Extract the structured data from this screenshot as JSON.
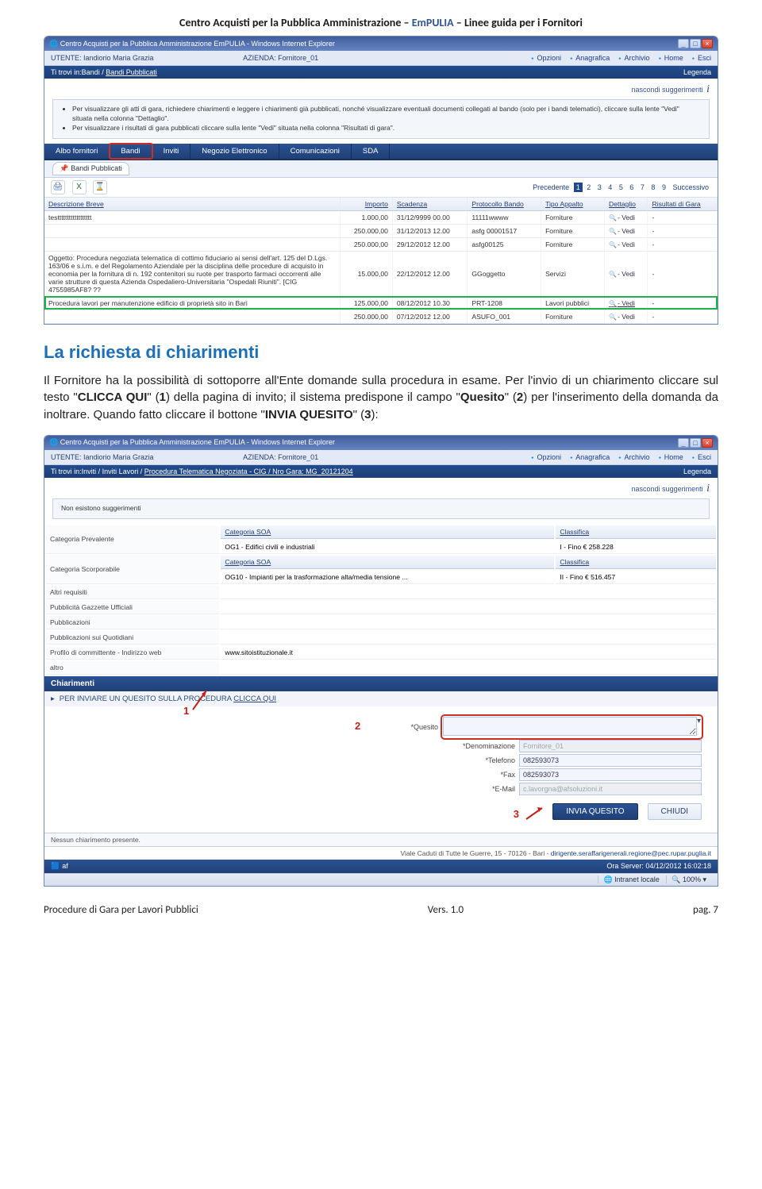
{
  "doc_header": {
    "left": "Centro Acquisti per la Pubblica Amministrazione – ",
    "mid": "EmPULIA",
    "right": " – Linee guida per i Fornitori"
  },
  "s1": {
    "title": "Centro Acquisti per la Pubblica Amministrazione EmPULIA - Windows Internet Explorer",
    "user_label": "UTENTE: Iandiorio Maria Grazia",
    "azienda_label": "AZIENDA: Fornitore_01",
    "links": {
      "opzioni": "Opzioni",
      "anagrafica": "Anagrafica",
      "archivio": "Archivio",
      "home": "Home",
      "esci": "Esci"
    },
    "crumb_prefix": "Ti trovi in:Bandi / ",
    "crumb_current": "Bandi Pubblicati",
    "legenda": "Legenda",
    "sugg_link": "nascondi suggerimenti",
    "sugg1": "Per visualizzare gli atti di gara, richiedere chiarimenti e leggere i chiarimenti già pubblicati, nonché visualizzare eventuali documenti collegati al bando (solo per i bandi telematici), cliccare sulla lente \"Vedi\" situata nella colonna \"Dettaglio\".",
    "sugg2": "Per visualizzare i risultati di gara pubblicati cliccare sulla lente \"Vedi\" situata nella colonna \"Risultati di gara\".",
    "tabs": [
      "Albo fornitori",
      "Bandi",
      "Inviti",
      "Negozio Elettronico",
      "Comunicazioni",
      "SDA"
    ],
    "subtab": "Bandi Pubblicati",
    "icon_print": "🖨",
    "icon_xls": "X",
    "icon_hourglass": "⌛",
    "pager": {
      "prev": "Precedente",
      "pages": [
        "1",
        "2",
        "3",
        "4",
        "5",
        "6",
        "7",
        "8",
        "9"
      ],
      "next": "Successivo"
    },
    "cols": [
      "Descrizione Breve",
      "Importo",
      "Scadenza",
      "Protocollo Bando",
      "Tipo Appalto",
      "Dettaglio",
      "Risultati di Gara"
    ],
    "vedi_text": "- Vedi",
    "rows": [
      {
        "desc": "testttttttttttttttttt",
        "importo": "1.000,00",
        "scad": "31/12/9999 00.00",
        "prot": "11111wwww",
        "tipo": "Forniture",
        "dash": "-"
      },
      {
        "desc": "",
        "importo": "250.000,00",
        "scad": "31/12/2013 12.00",
        "prot": "asfg 00001517",
        "tipo": "Forniture",
        "dash": "-"
      },
      {
        "desc": "",
        "importo": "250.000,00",
        "scad": "29/12/2012 12.00",
        "prot": "asfg00125",
        "tipo": "Forniture",
        "dash": "-"
      },
      {
        "desc": "Oggetto: Procedura negoziata telematica di cottimo fiduciario ai sensi dell'art. 125 del D.Lgs. 163/06 e s.i.m. e del Regolamento Aziendale per la disciplina delle procedure di acquisto in economia per la fornitura di n. 192 contenitori su ruote per trasporto farmaci occorrenti alle varie strutture di questa Azienda Ospedaliero-Universitaria \"Ospedali Riuniti\". [CIG 4755985AF8? ??",
        "importo": "15.000,00",
        "scad": "22/12/2012 12.00",
        "prot": "GGoggetto",
        "tipo": "Servizi",
        "dash": "-"
      },
      {
        "desc": "Procedura lavori per manutenzione edificio di proprietà sito in Bari",
        "importo": "125.000,00",
        "scad": "08/12/2012 10.30",
        "prot": "PRT-1208",
        "tipo": "Lavori pubblici",
        "dash": "-",
        "hl": true
      },
      {
        "desc": "",
        "importo": "250.000,00",
        "scad": "07/12/2012 12.00",
        "prot": "ASUFO_001",
        "tipo": "Forniture",
        "dash": "-"
      }
    ]
  },
  "body": {
    "h2": "La richiesta di chiarimenti",
    "p1a": "Il Fornitore ha la possibilità di sottoporre all'Ente domande sulla procedura in esame. Per l'invio di un chiarimento cliccare sul testo \"",
    "p1b": "CLICCA QUI",
    "p1c": "\" (",
    "p1d": "1",
    "p1e": ") della pagina di invito; il sistema predispone il campo \"",
    "p1f": "Quesito",
    "p1g": "\" (",
    "p1h": "2",
    "p1i": ") per l'inserimento della domanda da inoltrare. Quando fatto cliccare il bottone \"",
    "p1j": "INVIA QUESITO",
    "p1k": "\" (",
    "p1l": "3",
    "p1m": "):"
  },
  "s2": {
    "title": "Centro Acquisti per la Pubblica Amministrazione EmPULIA - Windows Internet Explorer",
    "user_label": "UTENTE: Iandiorio Maria Grazia",
    "azienda_label": "AZIENDA: Fornitore_01",
    "links": {
      "opzioni": "Opzioni",
      "anagrafica": "Anagrafica",
      "archivio": "Archivio",
      "home": "Home",
      "esci": "Esci"
    },
    "crumb_prefix": "Ti trovi in:Inviti / Inviti Lavori / ",
    "crumb_current": "Procedura Telematica Negoziata - CIG / Nro Gara: MG_20121204",
    "legenda": "Legenda",
    "sugg_link": "nascondi suggerimenti",
    "no_sugg": "Non esistono suggerimenti",
    "rows": [
      {
        "lbl": "Categoria Prevalente",
        "sub_lbl": "Categoria SOA",
        "sub_val": "OG1 - Edifici civili e industriali",
        "cls_lbl": "Classifica",
        "cls_val": "I - Fino € 258.228"
      },
      {
        "lbl": "Categoria Scorporabile",
        "sub_lbl": "Categoria SOA",
        "sub_val": "OG10 - Impianti per la trasformazione alta/media tensione ...",
        "cls_lbl": "Classifica",
        "cls_val": "II - Fino € 516.457"
      }
    ],
    "extra_rows": [
      {
        "lbl": "Altri requisiti",
        "val": ""
      },
      {
        "lbl": "Pubblicità Gazzette Ufficiali",
        "val": ""
      },
      {
        "lbl": "Pubblicazioni",
        "val": ""
      },
      {
        "lbl": "Pubblicazioni sui Quotidiani",
        "val": ""
      },
      {
        "lbl": "Profilo di committente - Indirizzo web",
        "val": "www.sitoistituzionale.it"
      },
      {
        "lbl": "altro",
        "val": ""
      }
    ],
    "chiarimenti_title": "Chiarimenti",
    "clicca_prefix": "PER INVIARE UN QUESITO SULLA PROCEDURA ",
    "clicca_link": "CLICCA QUI",
    "num1": "1",
    "num2": "2",
    "num3": "3",
    "quesito_lbl": "*Quesito",
    "denom_lbl": "*Denominazione",
    "denom_val": "Fornitore_01",
    "tel_lbl": "*Telefono",
    "tel_val": "082593073",
    "fax_lbl": "*Fax",
    "fax_val": "082593073",
    "email_lbl": "*E-Mail",
    "email_val": "c.lavorgna@afsoluzioni.it",
    "btn_invia": "INVIA QUESITO",
    "btn_chiudi": "CHIUDI",
    "no_chi": "Nessun chiarimento presente.",
    "footer_addr": "Viale Caduti di Tutte le Guerre, 15 - 70126 - Bari - ",
    "footer_email": "dirigente.seraffarigenerali.regione@pec.rupar.puglia.it",
    "status_af": "af",
    "status_clock": "Ora Server: 04/12/2012 16:02:18",
    "status_zone": "Intranet locale",
    "status_zoom": "🔍 100%"
  },
  "footer": {
    "left": "Procedure di Gara per Lavori Pubblici",
    "mid": "Vers. 1.0",
    "right": "pag. 7"
  }
}
